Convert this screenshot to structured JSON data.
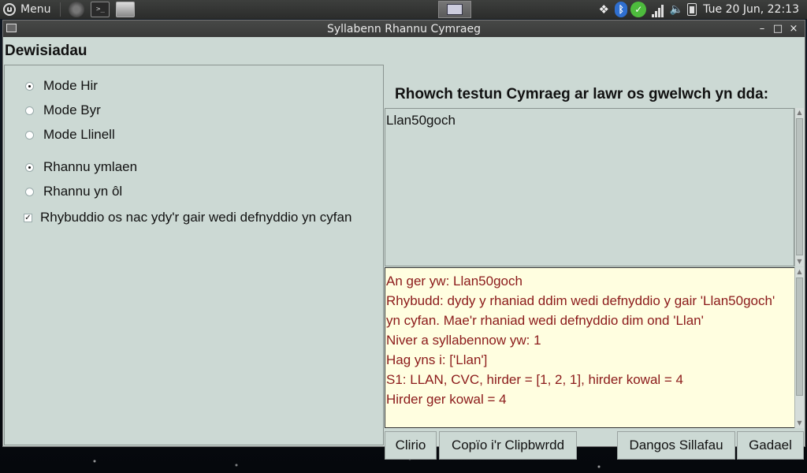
{
  "taskbar": {
    "menu_label": "Menu",
    "clock": "Tue 20 Jun, 22:13"
  },
  "window": {
    "title": "Syllabenn Rhannu Cymraeg",
    "controls": {
      "minimize": "–",
      "maximize": "□",
      "close": "×"
    }
  },
  "options": {
    "heading": "Dewisiadau",
    "mode": [
      {
        "label": "Mode Hir",
        "selected": true
      },
      {
        "label": "Mode Byr",
        "selected": false
      },
      {
        "label": "Mode Llinell",
        "selected": false
      }
    ],
    "split": [
      {
        "label": "Rhannu ymlaen",
        "selected": true
      },
      {
        "label": "Rhannu yn ôl",
        "selected": false
      }
    ],
    "warn_checkbox": {
      "label": "Rhybuddio os nac ydy'r gair wedi defnyddio yn cyfan",
      "checked": true
    }
  },
  "input": {
    "prompt": "Rhowch testun Cymraeg ar lawr os gwelwch yn dda:",
    "value": "Llan50goch"
  },
  "output": {
    "lines": [
      "An ger yw: Llan50goch",
      "Rhybudd: dydy y rhaniad ddim wedi defnyddio y gair 'Llan50goch' yn cyfan. Mae'r rhaniad wedi defnyddio dim ond 'Llan'",
      "Niver a syllabennow yw: 1",
      "Hag yns i: ['Llan']",
      "S1: LLAN, CVC, hirder = [1, 2, 1], hirder kowal = 4",
      "Hirder ger kowal = 4"
    ]
  },
  "buttons": {
    "clear": "Clirio",
    "copy": "Copïo i'r Clipbwrdd",
    "show_syllables": "Dangos Sillafau",
    "quit": "Gadael"
  },
  "colors": {
    "window_bg": "#ccd9d4",
    "output_bg": "#fffee0",
    "output_text": "#8b1a1a"
  }
}
